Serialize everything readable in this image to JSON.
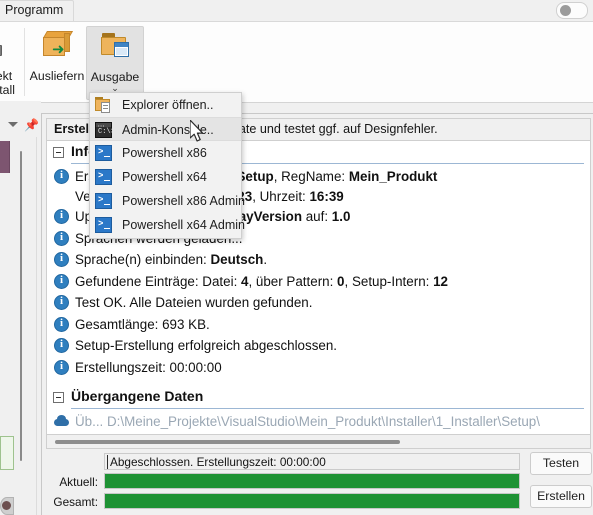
{
  "window": {
    "ribbon_tab": "Programm",
    "toggle_icon": "pill-toggle"
  },
  "ribbon": {
    "buttons": [
      {
        "label_line1": "ekt",
        "label_line2": "stall",
        "icon": "install-pen-icon",
        "clipped": true
      },
      {
        "label_line1": "Ausliefern",
        "label_line2": "",
        "icon": "deliver-box-icon",
        "clipped": false
      },
      {
        "label_line1": "Ausgabe",
        "label_line2": "",
        "icon": "output-folder-icon",
        "clipped": false,
        "chevron": "⌄",
        "active": true
      }
    ]
  },
  "dock": {
    "caret_icon": "chevron-down-icon",
    "pin_icon": "pin-icon"
  },
  "menu": {
    "items": [
      {
        "label": "Explorer öffnen..",
        "icon": "folder-document-icon",
        "selected": false
      },
      {
        "label": "Admin-Konsole..",
        "icon": "command-console-icon",
        "selected": true
      },
      {
        "label": "Powershell x86",
        "icon": "powershell-icon",
        "selected": false
      },
      {
        "label": "Powershell x64",
        "icon": "powershell-icon",
        "selected": false
      },
      {
        "label": "Powershell x86 Admin",
        "icon": "powershell-icon",
        "selected": false
      },
      {
        "label": "Powershell x64 Admin",
        "icon": "powershell-icon",
        "selected": false
      }
    ]
  },
  "document": {
    "title_bold": "Erstelle",
    "title_rest": "n. Erstellt das Setup/Update und testet ggf. auf Designfehler.",
    "groups": {
      "info": "Informationen",
      "skipped": "Übergangene Daten"
    },
    "log": [
      {
        "icon": "info-icon",
        "line1_a": "Ers",
        "line1_b": "telle Mein_Produkt als ",
        "text": "Erstelle Mein_Produkt als Setup, RegName: Mein_Produkt",
        "line2": "Version: 1.0, Datum: 25.04.23, Uhrzeit: 16:39",
        "two_lines": true
      },
      {
        "icon": "info-icon",
        "text": "Update-Registrierung DisplayVersion auf: 1.0"
      },
      {
        "icon": "info-icon",
        "text": "Sprachen werden geladen..."
      },
      {
        "icon": "info-icon",
        "text": "Sprache(n) einbinden: Deutsch."
      },
      {
        "icon": "info-icon",
        "text": "Gefundene Einträge: Datei: 4, über Pattern: 0, Setup-Intern: 12"
      },
      {
        "icon": "info-icon",
        "text": "Test OK. Alle Dateien wurden gefunden."
      },
      {
        "icon": "info-icon",
        "text": "Gesamtlänge: 693 KB."
      },
      {
        "icon": "info-icon",
        "text": "Setup-Erstellung erfolgreich abgeschlossen."
      },
      {
        "icon": "info-icon",
        "text": "Erstellungszeit: 00:00:00"
      }
    ],
    "skipped_row": {
      "icon": "cloud-icon",
      "text": "Üb...   D:\\Meine_Projekte\\VisualStudio\\Mein_Produkt\\Installer\\1_Installer\\Setup\\"
    }
  },
  "bottom": {
    "status": "Abgeschlossen. Erstellungszeit: 00:00:00",
    "bars": [
      {
        "label": "Aktuell:",
        "percent": 100
      },
      {
        "label": "Gesamt:",
        "percent": 100
      }
    ],
    "buttons": [
      {
        "label": "Testen"
      },
      {
        "label": "Erstellen"
      }
    ],
    "fill_color": "#1e9234"
  }
}
